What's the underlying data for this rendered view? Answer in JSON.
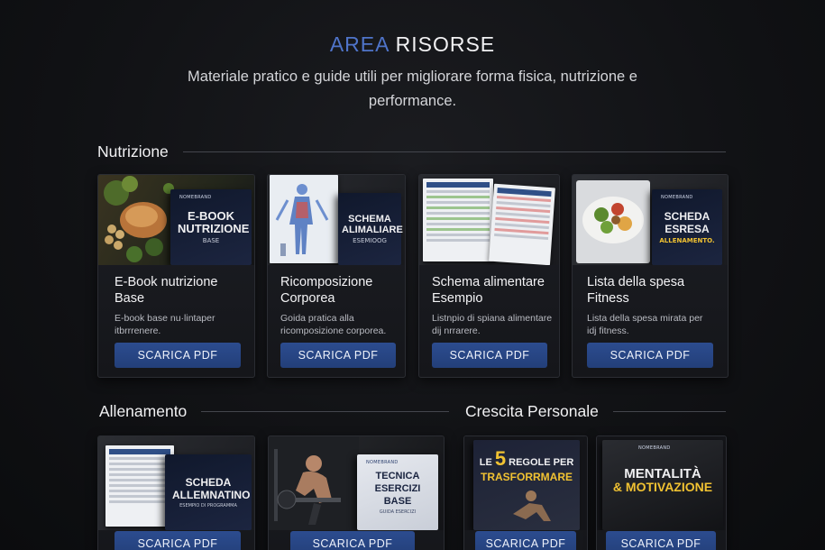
{
  "header": {
    "title_accent": "AREA",
    "title_rest": "RISORSE",
    "subtitle": "Materiale pratico e guide utili per migliorare forma fisica, nutrizione e performance."
  },
  "sections": {
    "nutrizione": "Nutrizione",
    "allenamento": "Allenamento",
    "crescita": "Crescita Personale"
  },
  "nutrizione_cards": [
    {
      "title": "E-Book nutrizione Base",
      "desc": "E-book base nu·lintaper itbrrrenere.",
      "button": "SCARICA PDF",
      "cover": {
        "brand": "NOMEBRAND",
        "title": "E-BOOK NUTRIZIONE",
        "sub": "BASE"
      }
    },
    {
      "title": "Ricomposizione Corporea",
      "desc": "Goida pratica alla ricomposizione corporea.",
      "button": "SCARICA PDF",
      "cover": {
        "title": "SCHEMA ALIMALIARE",
        "sub": "ESEMIOOG"
      }
    },
    {
      "title": "Schema alimentare Esempio",
      "desc": "Listnpio di spiana alimentare dij nrrarere.",
      "button": "SCARICA PDF"
    },
    {
      "title": "Lista della spesa Fitness",
      "desc": "Lista della spesa mirata per idj fitness.",
      "button": "SCARICA PDF",
      "cover": {
        "brand": "NOMEBRAND",
        "title": "SCHEDA ESRESA",
        "sub": "ALLENAMENTO."
      }
    }
  ],
  "allenamento_cards": [
    {
      "button": "SCARICA PDF",
      "cover": {
        "title": "SCHEDA ALLEMNATINO",
        "sub": "ESEMPIO DI PROGRAMMA"
      }
    },
    {
      "button": "SCARICA PDF",
      "cover": {
        "brand": "NOMEBRAND",
        "title": "TECNICA ESERCIZI BASE",
        "sub": "GUIDA ESERCIZI"
      }
    }
  ],
  "crescita_cards": [
    {
      "button": "SCARICA PDF",
      "cover": {
        "line1": "LE",
        "num": "5",
        "line2": "REGOLE PER",
        "line3": "TRASFORRMARE"
      }
    },
    {
      "button": "SCARICA PDF",
      "cover": {
        "brand": "NOMEBRAND",
        "title": "MENTALITÀ",
        "title2": "& MOTIVAZIONE"
      }
    }
  ],
  "colors": {
    "accent": "#4f74c9",
    "button": "#2c4c8f",
    "yellow": "#f1c232"
  }
}
